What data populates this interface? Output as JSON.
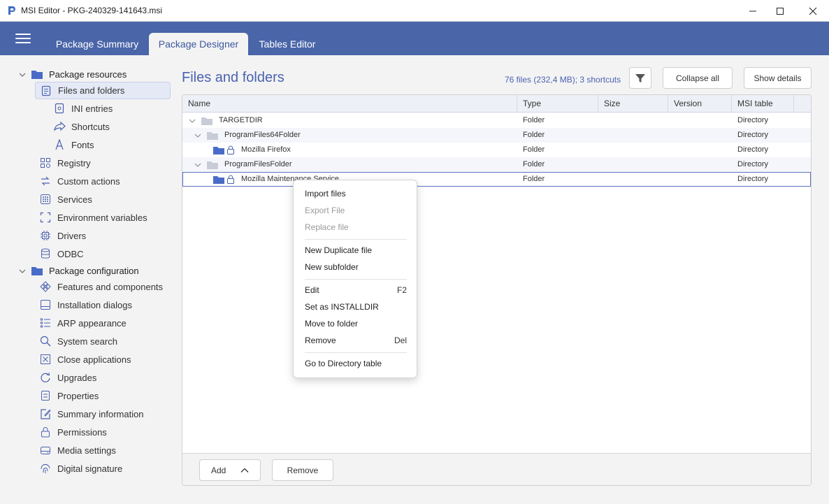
{
  "window": {
    "title": "MSI Editor - PKG-240329-141643.msi"
  },
  "tabs": [
    {
      "label": "Package Summary"
    },
    {
      "label": "Package Designer"
    },
    {
      "label": "Tables Editor"
    }
  ],
  "sidebar": {
    "groups": [
      {
        "label": "Package resources"
      },
      {
        "label": "Package configuration"
      }
    ],
    "items": [
      {
        "label": "Files and folders",
        "icon": "file-list-icon"
      },
      {
        "label": "INI entries",
        "icon": "ini-icon"
      },
      {
        "label": "Shortcuts",
        "icon": "shortcut-icon"
      },
      {
        "label": "Fonts",
        "icon": "font-icon"
      },
      {
        "label": "Registry",
        "icon": "registry-icon"
      },
      {
        "label": "Custom actions",
        "icon": "custom-actions-icon"
      },
      {
        "label": "Services",
        "icon": "services-icon"
      },
      {
        "label": "Environment variables",
        "icon": "environment-icon"
      },
      {
        "label": "Drivers",
        "icon": "driver-chip-icon"
      },
      {
        "label": "ODBC",
        "icon": "database-icon"
      },
      {
        "label": "Features and components",
        "icon": "features-icon"
      },
      {
        "label": "Installation dialogs",
        "icon": "dialog-icon"
      },
      {
        "label": "ARP appearance",
        "icon": "arp-list-icon"
      },
      {
        "label": "System search",
        "icon": "search-icon"
      },
      {
        "label": "Close applications",
        "icon": "close-box-icon"
      },
      {
        "label": "Upgrades",
        "icon": "upgrade-icon"
      },
      {
        "label": "Properties",
        "icon": "properties-icon"
      },
      {
        "label": "Summary information",
        "icon": "summary-edit-icon"
      },
      {
        "label": "Permissions",
        "icon": "lock-icon"
      },
      {
        "label": "Media settings",
        "icon": "media-icon"
      },
      {
        "label": "Digital signature",
        "icon": "fingerprint-icon"
      }
    ]
  },
  "main": {
    "title": "Files and folders",
    "count_text": "76 files (232,4 MB); 3 shortcuts",
    "collapse_label": "Collapse all",
    "details_label": "Show details"
  },
  "table": {
    "columns": [
      "Name",
      "Type",
      "Size",
      "Version",
      "MSI table"
    ],
    "rows": [
      {
        "name": "TARGETDIR",
        "type": "Folder",
        "size": "",
        "version": "",
        "msi_table": "Directory"
      },
      {
        "name": "ProgramFiles64Folder",
        "type": "Folder",
        "size": "",
        "version": "",
        "msi_table": "Directory"
      },
      {
        "name": "Mozilla Firefox",
        "type": "Folder",
        "size": "",
        "version": "",
        "msi_table": "Directory"
      },
      {
        "name": "ProgramFilesFolder",
        "type": "Folder",
        "size": "",
        "version": "",
        "msi_table": "Directory"
      },
      {
        "name": "Mozilla Maintenance Service",
        "type": "Folder",
        "size": "",
        "version": "",
        "msi_table": "Directory"
      }
    ]
  },
  "footer": {
    "add_label": "Add",
    "remove_label": "Remove"
  },
  "context_menu": {
    "items": [
      {
        "label": "Import files",
        "shortcut": "",
        "disabled": false
      },
      {
        "label": "Export File",
        "shortcut": "",
        "disabled": true
      },
      {
        "label": "Replace file",
        "shortcut": "",
        "disabled": true
      },
      {
        "label": "New Duplicate file",
        "shortcut": "",
        "disabled": false
      },
      {
        "label": "New subfolder",
        "shortcut": "",
        "disabled": false
      },
      {
        "label": "Edit",
        "shortcut": "F2",
        "disabled": false
      },
      {
        "label": "Set as INSTALLDIR",
        "shortcut": "",
        "disabled": false
      },
      {
        "label": "Move to folder",
        "shortcut": "",
        "disabled": false
      },
      {
        "label": "Remove",
        "shortcut": "Del",
        "disabled": false
      },
      {
        "label": "Go to Directory table",
        "shortcut": "",
        "disabled": false
      }
    ]
  },
  "colors": {
    "accent": "#4a65a8",
    "title_blue": "#4a62b0",
    "folder_blue": "#4a6cc8",
    "folder_gray": "#c8ccd6"
  }
}
